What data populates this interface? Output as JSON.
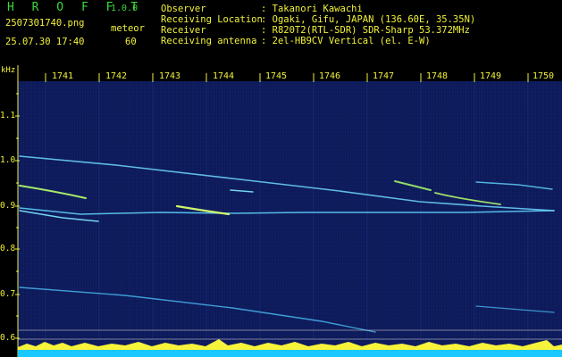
{
  "app": {
    "name": "H R O F F T",
    "version": "1.0.0"
  },
  "capture": {
    "filename": "2507301740.png",
    "datetime": "25.07.30 17:40",
    "mode": "meteor",
    "count": "60"
  },
  "info": [
    {
      "field": "Observer",
      "value": ": Takanori Kawachi"
    },
    {
      "field": "Receiving Location",
      "value": ": Ogaki, Gifu, JAPAN (136.60E, 35.35N)"
    },
    {
      "field": "Receiver",
      "value": ": R820T2(RTL-SDR) SDR-Sharp 53.372MHz"
    },
    {
      "field": "Receiving antenna",
      "value": ": 2el-HB9CV Vertical (el. E-W)"
    }
  ],
  "spectrogram": {
    "y_unit": "kHz",
    "y_ticks": [
      "1.1",
      "1.0",
      "0.9",
      "0.8",
      "0.7",
      "0.6"
    ],
    "x_ticks": [
      "1741",
      "1742",
      "1743",
      "1744",
      "1745",
      "1746",
      "1747",
      "1748",
      "1749",
      "1750"
    ],
    "colors": {
      "background": "#0c1a5a",
      "trace": "#5fd3ff",
      "bright_trace": "#b7ff6a",
      "baseline": "#19c8ff",
      "noise_peak": "#f7f23a",
      "axis": "#f2f23a"
    }
  }
}
